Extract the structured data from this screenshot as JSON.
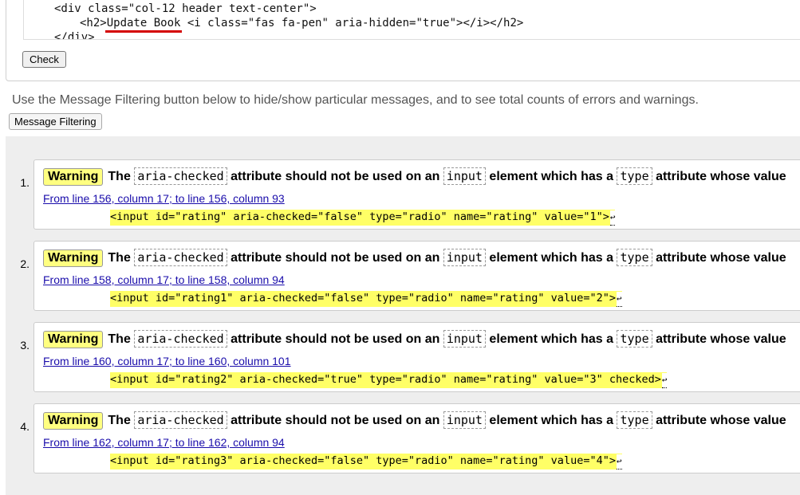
{
  "source": {
    "lines": [
      "<div class=\"col-12 header text-center\">",
      "<h2>",
      "Update Book",
      " <i class=\"fas fa-pen\" aria-hidden=\"true\"></i></h2>",
      "</div>"
    ],
    "check_label": "Check"
  },
  "info_text": "Use the Message Filtering button below to hide/show particular messages, and to see total counts of errors and warnings.",
  "filter_label": "Message Filtering",
  "messages": [
    {
      "num": "1.",
      "type": "Warning",
      "the": "The",
      "attr": "aria-checked",
      "mid1": "attribute should not be used on an",
      "el": "input",
      "mid2": "element which has a",
      "type_attr": "type",
      "tail": "attribute whose value",
      "location": "From line 156, column 17; to line 156, column 93",
      "code": "<input id=\"rating\" aria-checked=\"false\" type=\"radio\" name=\"rating\" value=\"1\">"
    },
    {
      "num": "2.",
      "type": "Warning",
      "the": "The",
      "attr": "aria-checked",
      "mid1": "attribute should not be used on an",
      "el": "input",
      "mid2": "element which has a",
      "type_attr": "type",
      "tail": "attribute whose value",
      "location": "From line 158, column 17; to line 158, column 94",
      "code": "<input id=\"rating1\" aria-checked=\"false\" type=\"radio\" name=\"rating\" value=\"2\">"
    },
    {
      "num": "3.",
      "type": "Warning",
      "the": "The",
      "attr": "aria-checked",
      "mid1": "attribute should not be used on an",
      "el": "input",
      "mid2": "element which has a",
      "type_attr": "type",
      "tail": "attribute whose value",
      "location": "From line 160, column 17; to line 160, column 101",
      "code": "<input id=\"rating2\" aria-checked=\"true\" type=\"radio\" name=\"rating\" value=\"3\" checked>"
    },
    {
      "num": "4.",
      "type": "Warning",
      "the": "The",
      "attr": "aria-checked",
      "mid1": "attribute should not be used on an",
      "el": "input",
      "mid2": "element which has a",
      "type_attr": "type",
      "tail": "attribute whose value",
      "location": "From line 162, column 17; to line 162, column 94",
      "code": "<input id=\"rating3\" aria-checked=\"false\" type=\"radio\" name=\"rating\" value=\"4\">"
    }
  ],
  "return_glyph": "↩",
  "colors": {
    "highlight": "#ffff66",
    "badge": "#ffff80",
    "error_underline": "#d40000",
    "link": "#1a0dab"
  }
}
